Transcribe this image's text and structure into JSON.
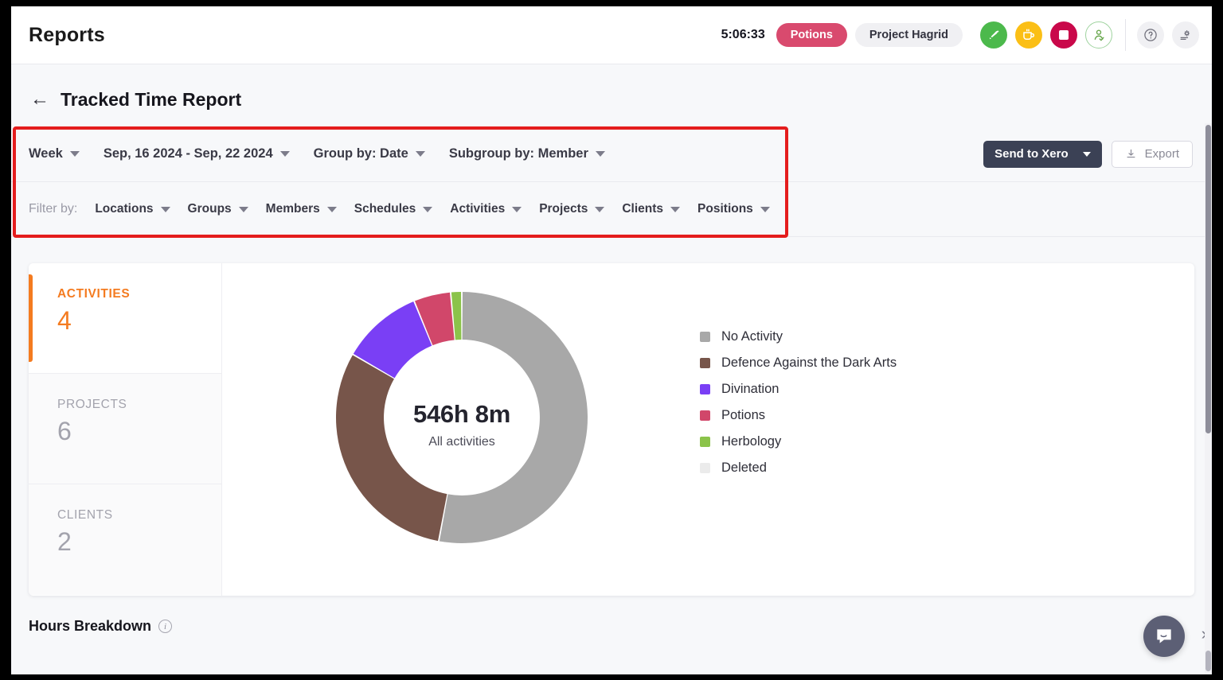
{
  "topbar": {
    "app_title": "Reports",
    "timer": "5:06:33",
    "activity_pill": "Potions",
    "project_pill": "Project Hagrid",
    "icons": {
      "start": "rocket-icon",
      "break": "coffee-cup-icon",
      "stop": "stop-square-icon",
      "user_clock": "user-check-icon",
      "help": "help-circle-icon",
      "settings": "gear-settings-icon"
    }
  },
  "page": {
    "back_arrow": "←",
    "title": "Tracked Time Report"
  },
  "filters": {
    "period": "Week",
    "date_range": "Sep, 16 2024 - Sep, 22 2024",
    "group_by": "Group by: Date",
    "subgroup_by": "Subgroup by: Member",
    "filter_by_label": "Filter by:",
    "filter_items": [
      "Locations",
      "Groups",
      "Members",
      "Schedules",
      "Activities",
      "Projects",
      "Clients",
      "Positions"
    ],
    "highlight_color": "#e41d1d"
  },
  "actions": {
    "send_to_xero": "Send to Xero",
    "export": "Export",
    "export_icon": "download-icon",
    "xero_bg": "#3b4155"
  },
  "stats": [
    {
      "label": "ACTIVITIES",
      "value": "4",
      "active": true
    },
    {
      "label": "PROJECTS",
      "value": "6",
      "active": false
    },
    {
      "label": "CLIENTS",
      "value": "2",
      "active": false
    }
  ],
  "chart_data": {
    "type": "pie",
    "title": "All activities",
    "center_total": "546h 8m",
    "center_label": "All activities",
    "legend_position": "right",
    "categories": [
      "No Activity",
      "Defence Against the Dark Arts",
      "Divination",
      "Potions",
      "Herbology",
      "Deleted"
    ],
    "values": [
      52.2,
      30.0,
      10.3,
      4.7,
      1.4,
      0.0
    ],
    "units": "percent of total tracked time",
    "colors": [
      "#a8a8a8",
      "#77554a",
      "#7a3ff5",
      "#d1476a",
      "#8bc34a",
      "#ebebeb"
    ],
    "donut": true,
    "inner_radius_ratio": 0.62
  },
  "hours_breakdown": {
    "title": "Hours Breakdown",
    "info_icon": "info-circle-icon",
    "info_glyph": "i"
  },
  "chat": {
    "fab_icon": "chat-bubble-icon",
    "expand_icon": "chevron-right-icon",
    "expand_glyph": "›"
  }
}
